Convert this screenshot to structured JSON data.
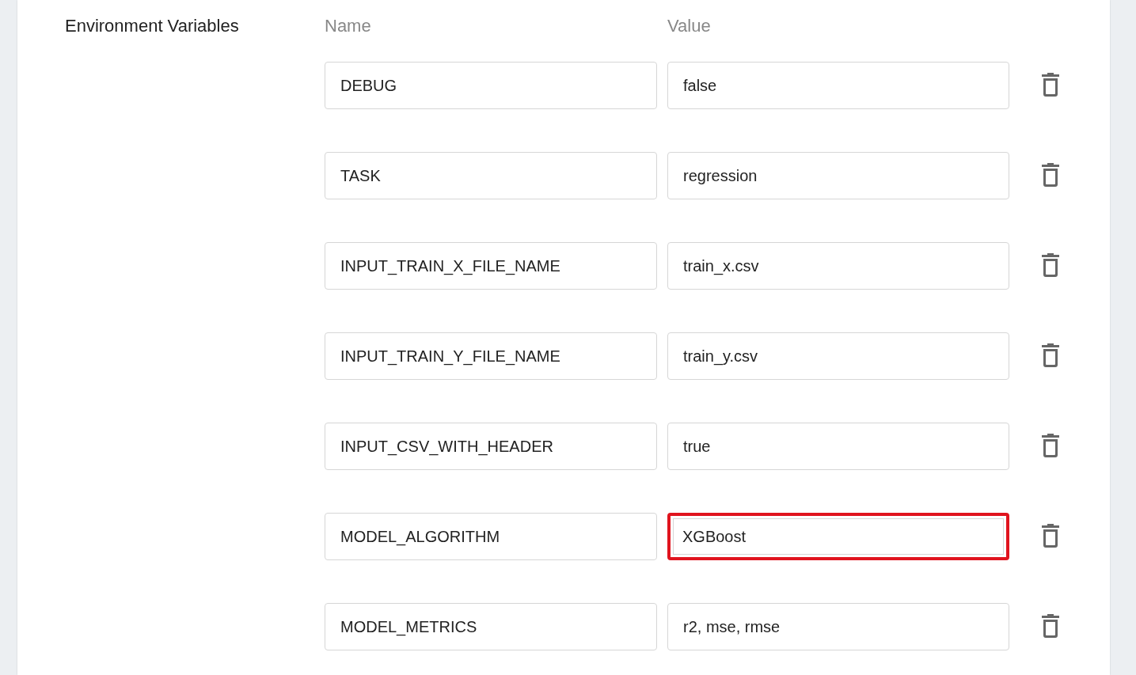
{
  "section_label": "Environment Variables",
  "columns": [
    "Name",
    "Value"
  ],
  "rows": [
    {
      "name": "DEBUG",
      "value": "false",
      "highlighted": false
    },
    {
      "name": "TASK",
      "value": "regression",
      "highlighted": false
    },
    {
      "name": "INPUT_TRAIN_X_FILE_NAME",
      "value": "train_x.csv",
      "highlighted": false
    },
    {
      "name": "INPUT_TRAIN_Y_FILE_NAME",
      "value": "train_y.csv",
      "highlighted": false
    },
    {
      "name": "INPUT_CSV_WITH_HEADER",
      "value": "true",
      "highlighted": false
    },
    {
      "name": "MODEL_ALGORITHM",
      "value": "XGBoost",
      "highlighted": true
    },
    {
      "name": "MODEL_METRICS",
      "value": "r2, mse, rmse",
      "highlighted": false
    }
  ]
}
